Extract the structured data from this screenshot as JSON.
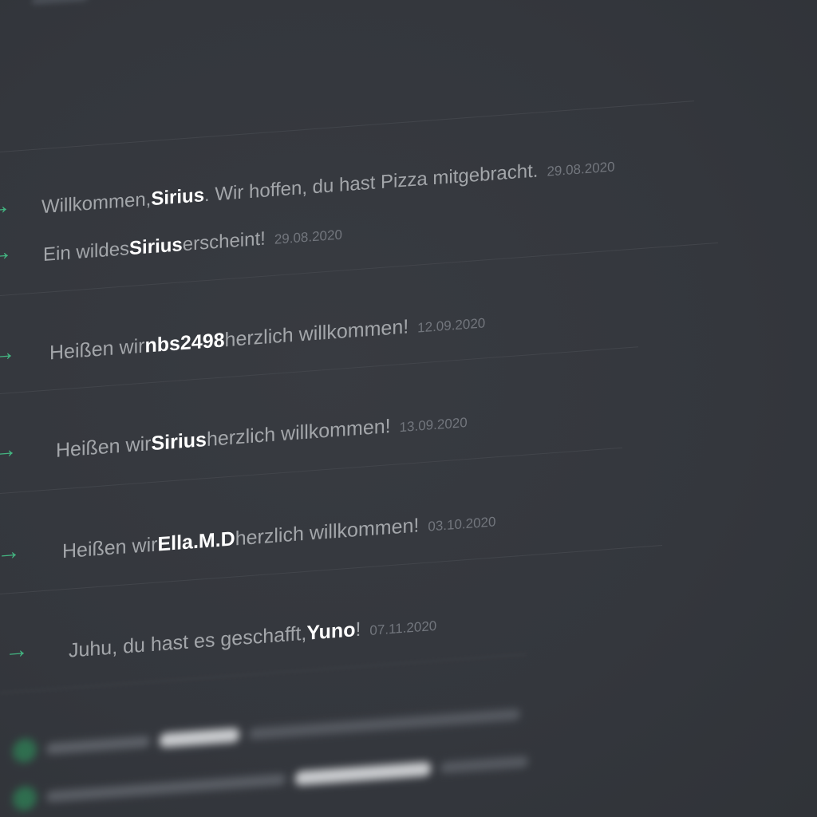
{
  "header": {
    "username": "",
    "meta": ""
  },
  "messages": [
    {
      "prefix": "Willkommen, ",
      "user": "Sirius",
      "suffix": ". Wir hoffen, du hast Pizza mitgebracht.",
      "date": "29.08.2020"
    },
    {
      "prefix": "Ein wildes ",
      "user": "Sirius",
      "suffix": " erscheint!",
      "date": "29.08.2020"
    },
    {
      "prefix": "Heißen wir ",
      "user": "nbs2498",
      "suffix": " herzlich willkommen!",
      "date": "12.09.2020"
    },
    {
      "prefix": "Heißen wir ",
      "user": "Sirius",
      "suffix": " herzlich willkommen!",
      "date": "13.09.2020"
    },
    {
      "prefix": "Heißen wir ",
      "user": "Ella.M.D",
      "suffix": " herzlich willkommen!",
      "date": "03.10.2020"
    },
    {
      "prefix": "Juhu, du hast es geschafft, ",
      "user": "Yuno",
      "suffix": "!",
      "date": "07.11.2020"
    }
  ],
  "icons": {
    "join_arrow": "→",
    "join_arrow_color": "#43b581"
  },
  "colors": {
    "background": "#36393f",
    "text": "#a3a6aa",
    "username": "#ffffff",
    "timestamp": "#72767d",
    "accent_green": "#43b581"
  }
}
